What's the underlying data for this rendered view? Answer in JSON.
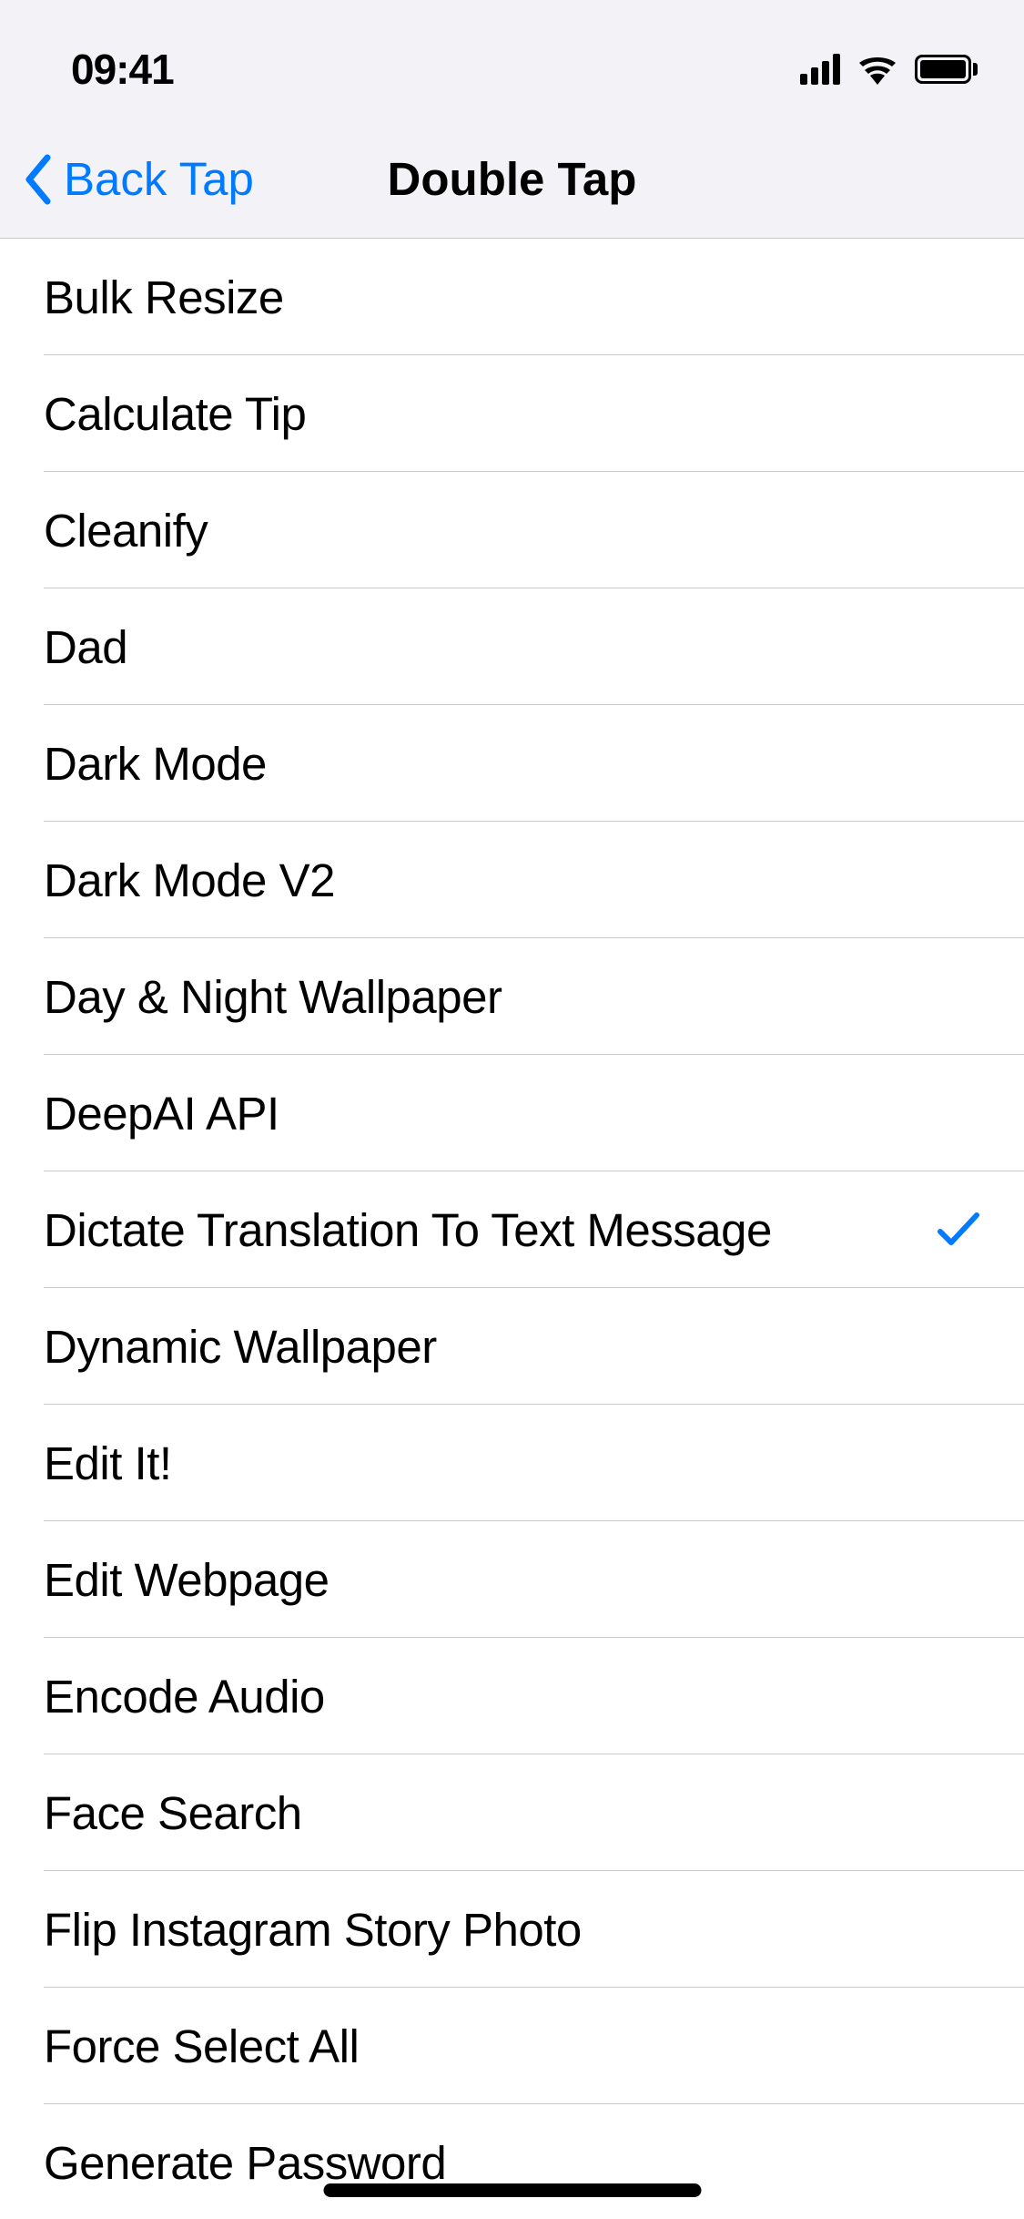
{
  "statusbar": {
    "time": "09:41"
  },
  "nav": {
    "back_label": "Back Tap",
    "title": "Double Tap"
  },
  "list": {
    "items": [
      {
        "label": "Bulk Resize",
        "selected": false
      },
      {
        "label": "Calculate Tip",
        "selected": false
      },
      {
        "label": "Cleanify",
        "selected": false
      },
      {
        "label": "Dad",
        "selected": false
      },
      {
        "label": "Dark Mode",
        "selected": false
      },
      {
        "label": "Dark Mode V2",
        "selected": false
      },
      {
        "label": "Day & Night Wallpaper",
        "selected": false
      },
      {
        "label": "DeepAI API",
        "selected": false
      },
      {
        "label": "Dictate Translation To Text Message",
        "selected": true
      },
      {
        "label": "Dynamic Wallpaper",
        "selected": false
      },
      {
        "label": "Edit It!",
        "selected": false
      },
      {
        "label": "Edit Webpage",
        "selected": false
      },
      {
        "label": "Encode Audio",
        "selected": false
      },
      {
        "label": "Face Search",
        "selected": false
      },
      {
        "label": "Flip Instagram Story Photo",
        "selected": false
      },
      {
        "label": "Force Select All",
        "selected": false
      },
      {
        "label": "Generate Password",
        "selected": false
      }
    ]
  },
  "colors": {
    "accent": "#007aff",
    "separator": "#c7c7cc",
    "header_bg": "#f2f2f7"
  }
}
